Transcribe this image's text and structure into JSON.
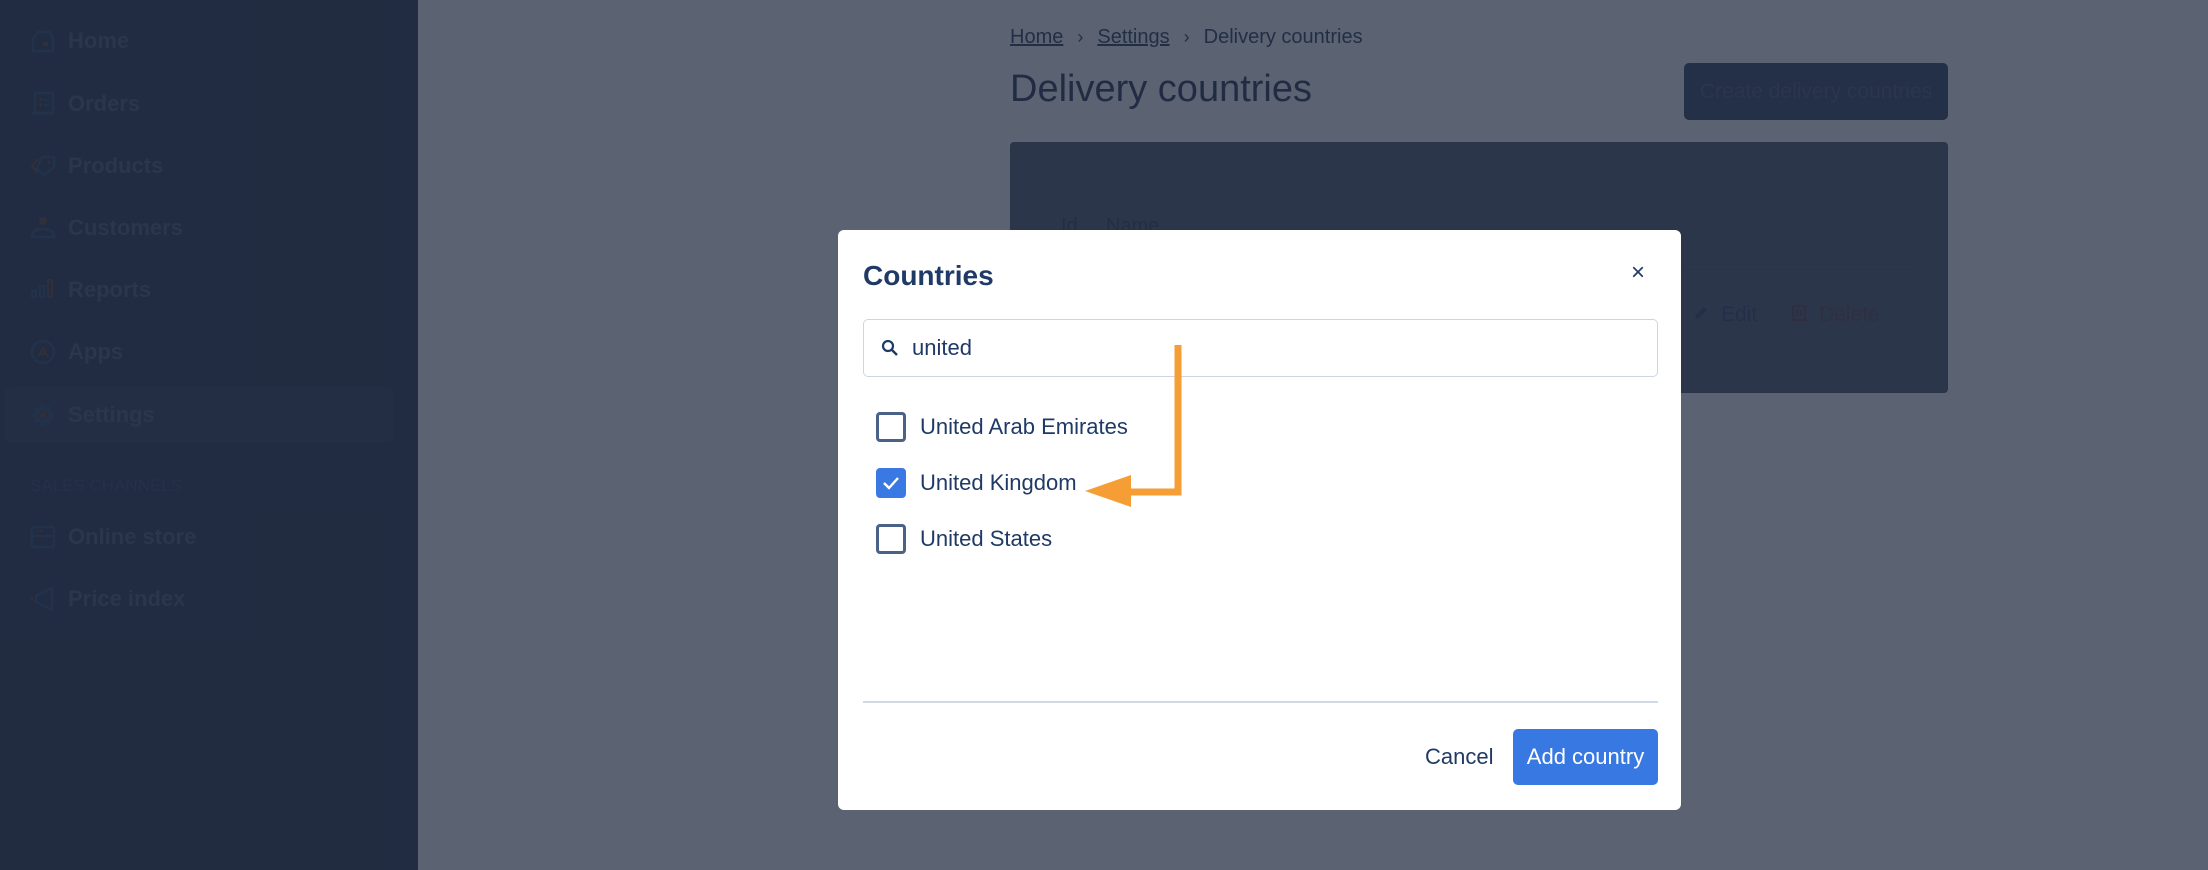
{
  "sidebar": {
    "items": [
      {
        "label": "Home",
        "icon": "home-icon"
      },
      {
        "label": "Orders",
        "icon": "orders-icon"
      },
      {
        "label": "Products",
        "icon": "tag-icon"
      },
      {
        "label": "Customers",
        "icon": "user-icon"
      },
      {
        "label": "Reports",
        "icon": "bar-chart-icon"
      },
      {
        "label": "Apps",
        "icon": "apps-icon"
      },
      {
        "label": "Settings",
        "icon": "gear-icon",
        "active": true
      }
    ],
    "section_title": "SALES CHANNELS",
    "channels": [
      {
        "label": "Online store",
        "icon": "store-icon"
      },
      {
        "label": "Price index",
        "icon": "megaphone-icon"
      }
    ]
  },
  "breadcrumb": {
    "items": [
      "Home",
      "Settings",
      "Delivery countries"
    ],
    "separator": "›"
  },
  "page": {
    "title": "Delivery countries",
    "create_button": "Create delivery countries",
    "table": {
      "headers": [
        "Id",
        "Name"
      ],
      "actions": {
        "edit": "Edit",
        "delete": "Delete"
      }
    }
  },
  "modal": {
    "title": "Countries",
    "close_symbol": "×",
    "search": {
      "value": "united",
      "placeholder": ""
    },
    "countries": [
      {
        "name": "United Arab Emirates",
        "checked": false
      },
      {
        "name": "United Kingdom",
        "checked": true
      },
      {
        "name": "United States",
        "checked": false
      }
    ],
    "cancel_label": "Cancel",
    "add_label": "Add country"
  },
  "colors": {
    "primary": "#3878e3",
    "annotation_arrow": "#f59e35",
    "sidebar_bg": "#273049",
    "text_dark": "#1f3a66"
  }
}
